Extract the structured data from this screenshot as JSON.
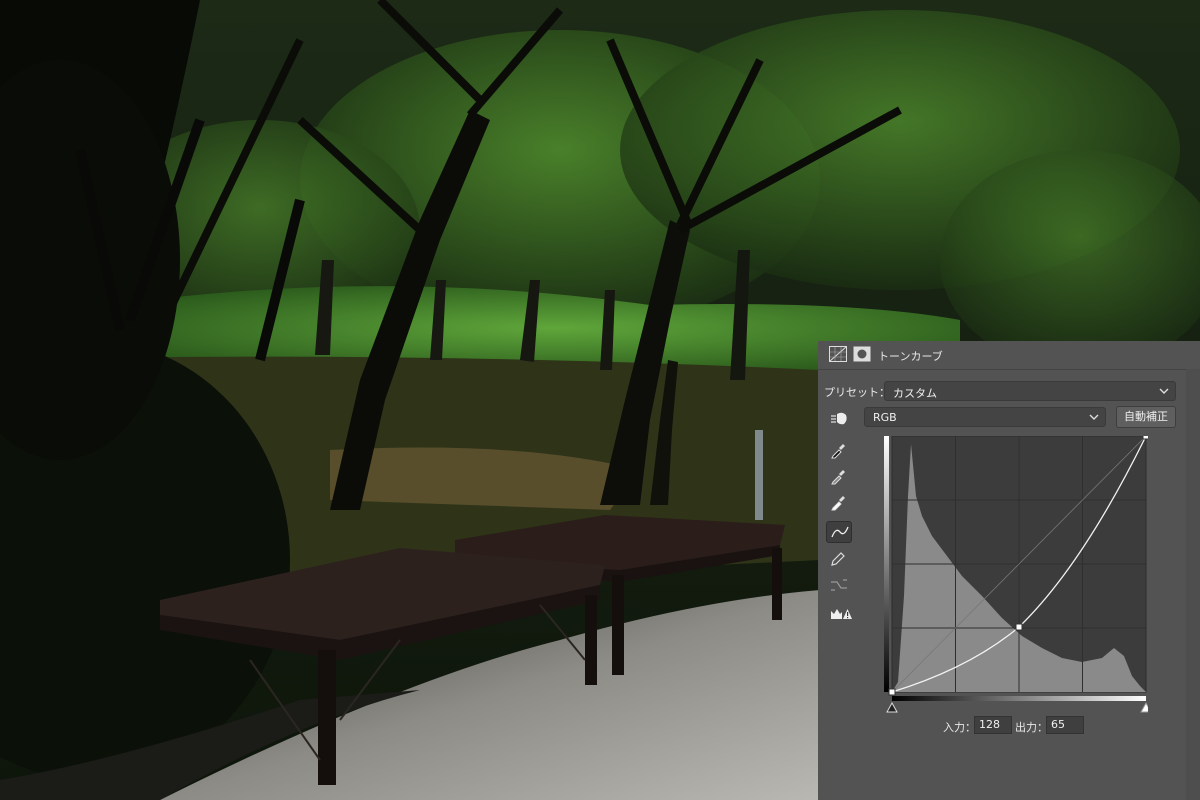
{
  "panel": {
    "title": "トーンカーブ",
    "preset_label": "プリセット：",
    "preset_value": "カスタム",
    "channel_value": "RGB",
    "auto_button": "自動補正",
    "input_label": "入力：",
    "input_value": "128",
    "output_label": "出力：",
    "output_value": "65",
    "tools": [
      "target-adjust-icon",
      "black-point-eyedropper-icon",
      "gray-point-eyedropper-icon",
      "white-point-eyedropper-icon",
      "curve-point-icon",
      "pencil-icon",
      "smooth-curve-icon",
      "clipping-warning-icon"
    ]
  },
  "curve": {
    "points": [
      [
        0,
        0
      ],
      [
        128,
        65
      ],
      [
        255,
        255
      ]
    ],
    "selected_point": [
      128,
      65
    ]
  },
  "colors": {
    "panel_bg": "#535353",
    "graph_bg": "#3c3c3c",
    "histogram": "#8a8a8a"
  }
}
